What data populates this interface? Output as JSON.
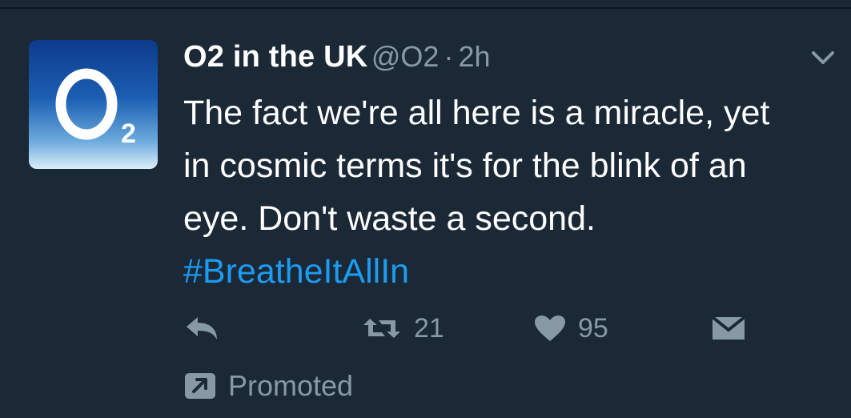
{
  "tweet": {
    "author": {
      "display_name": "O2 in the UK",
      "handle": "@O2",
      "avatar_logo": "O2"
    },
    "separator": "·",
    "time": "2h",
    "text_lines": [
      "The fact we're all here is a miracle, yet",
      "in cosmic terms it's for the blink of an",
      "eye. Don't waste a second."
    ],
    "hashtag": "#BreatheItAllIn",
    "actions": {
      "reply_icon": "reply-icon",
      "retweet_icon": "retweet-icon",
      "retweet_count": "21",
      "like_icon": "heart-icon",
      "like_count": "95",
      "dm_icon": "envelope-icon"
    },
    "promoted_label": "Promoted"
  },
  "colors": {
    "background": "#1b2836",
    "text": "#ffffff",
    "muted": "#8899a6",
    "link": "#1d9bf0"
  }
}
